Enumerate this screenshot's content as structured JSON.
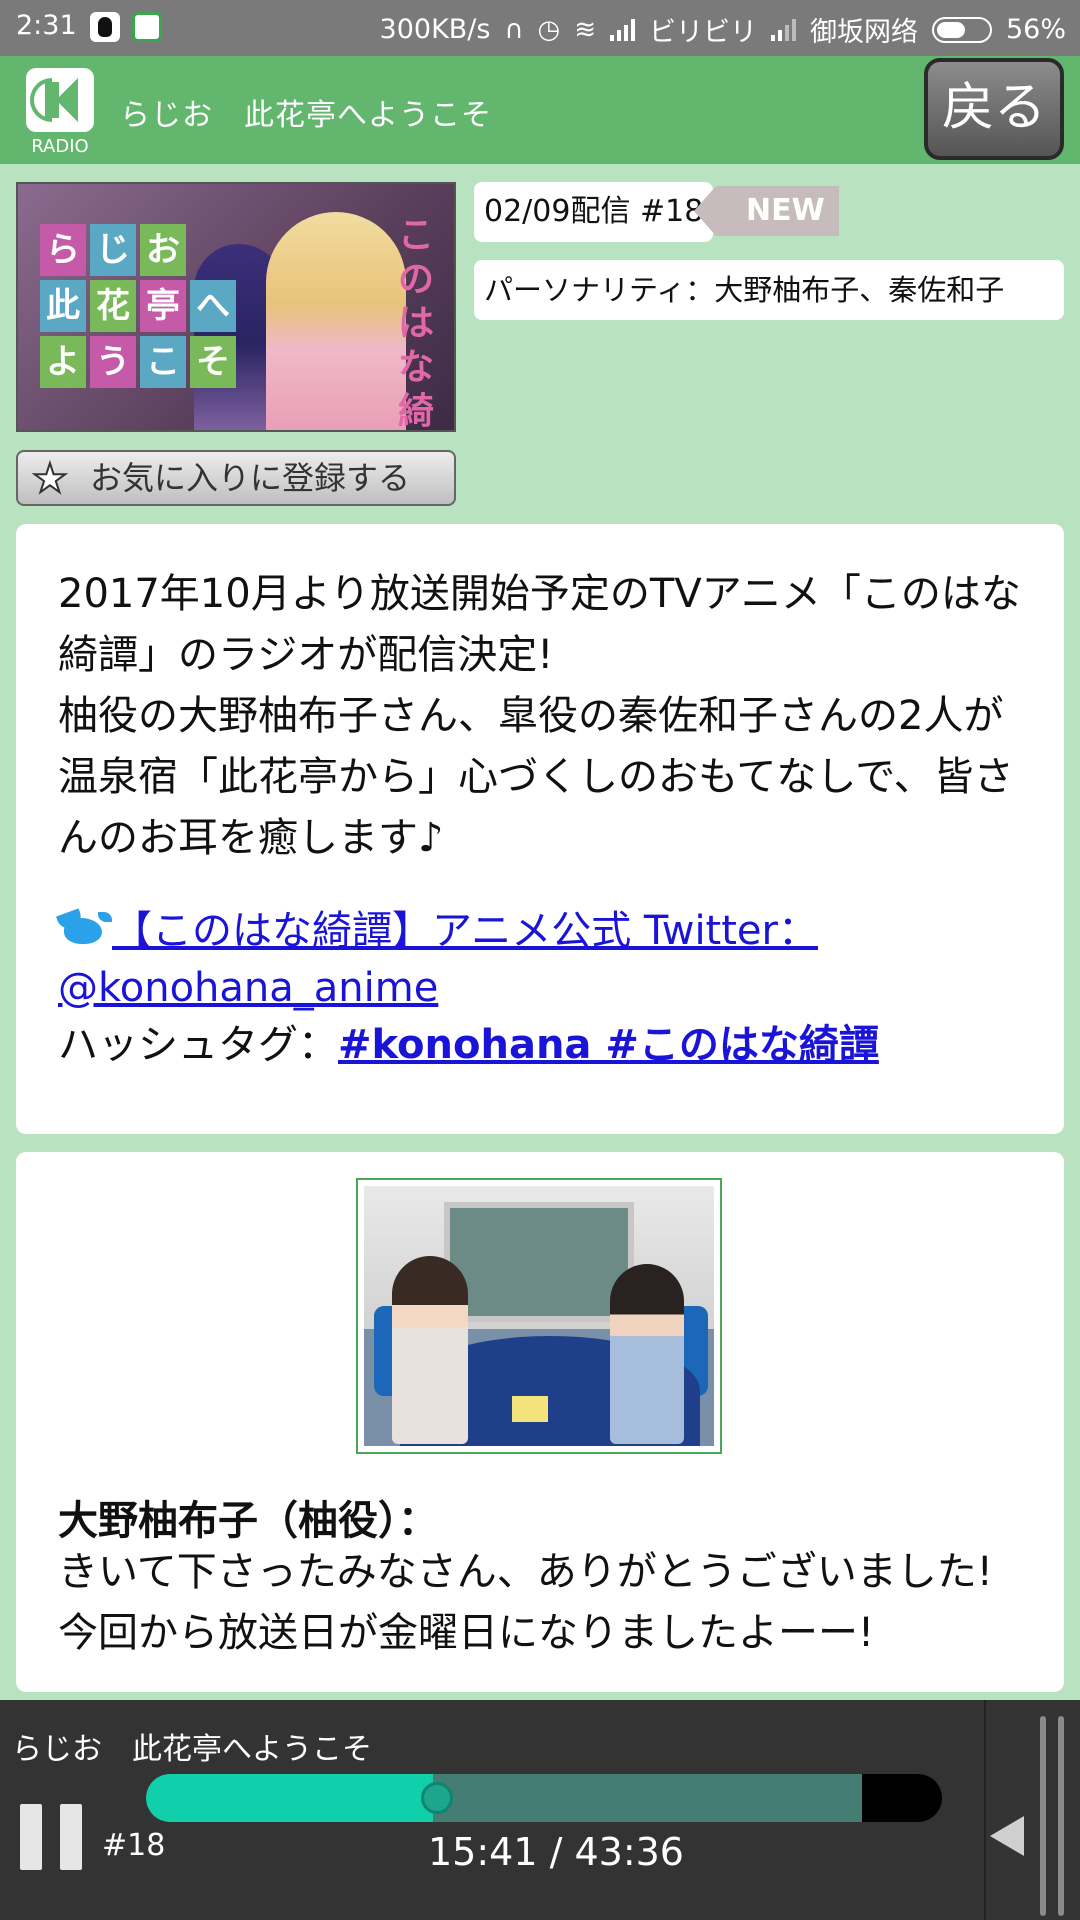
{
  "status_bar": {
    "time": "2:31",
    "net_speed": "300KB/s",
    "carrier1": "ビリビリ",
    "carrier2": "御坂网络",
    "battery_text": "56%",
    "battery_level": 0.56,
    "icons": [
      "qq-icon",
      "bilibili-app-icon",
      "headphones-icon",
      "alarm-icon",
      "wifi-icon",
      "signal-icon"
    ]
  },
  "header": {
    "logo_label": "RADIO",
    "title": "らじお　此花亭へようこそ",
    "back_label": "戻る"
  },
  "thumbnail": {
    "grid_chars": [
      "ら",
      "じ",
      "お",
      "",
      "此",
      "花",
      "亭",
      "へ",
      "よ",
      "う",
      "こ",
      "そ"
    ],
    "side_title": "このはな綺譚"
  },
  "episode": {
    "date_label": "02/09配信 #18",
    "new_tag": "NEW",
    "personality": "パーソナリティ：大野柚布子、秦佐和子",
    "favorite_label": "お気に入りに登録する"
  },
  "description": {
    "paragraph1": "2017年10月より放送開始予定のTVアニメ「このはな綺譚」のラジオが配信決定!",
    "paragraph2": "柚役の大野柚布子さん、皐役の秦佐和子さんの2人が温泉宿「此花亭から」心づくしのおもてなしで、皆さんのお耳を癒します♪",
    "twitter_link": "【このはな綺譚】アニメ公式 Twitter：@konohana_anime",
    "hashtag_label": "ハッシュタグ：",
    "hashtags": "#konohana #このはな綺譚"
  },
  "comment": {
    "speaker": "大野柚布子（柚役）：",
    "text": "きいて下さったみなさん、ありがとうございました!",
    "text_cutoff": "今回から放送日が金曜日になりましたよーー!"
  },
  "player": {
    "title": "らじお　此花亭へようこそ",
    "episode": "#18",
    "current_time": "15:41",
    "total_time": "43:36",
    "time_display": "15:41 / 43:36",
    "played_fraction": 0.36,
    "buffered_fraction": 0.9
  },
  "colors": {
    "header_green": "#63b66d",
    "page_bg": "#b9e2c0",
    "link_blue": "#1a13d8",
    "progress_played": "#12cfab",
    "progress_buffered": "#447d74"
  }
}
